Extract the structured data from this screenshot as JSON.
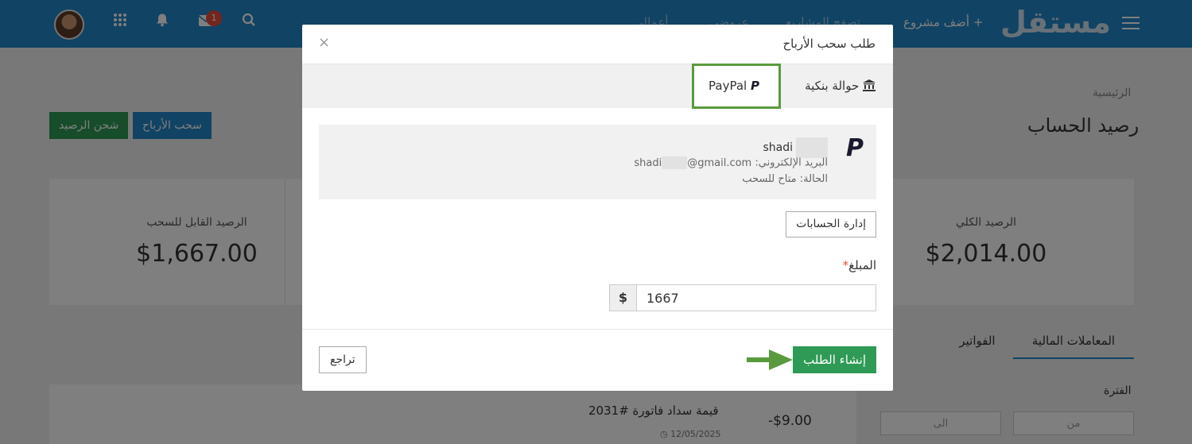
{
  "navbar": {
    "logo": "مستقل",
    "add_project": "+ أضف مشروع",
    "browse_projects": "تصفح المشاريع",
    "my_offers": "عروضي",
    "my_jobs": "أعمالي",
    "mail_badge": "1",
    "icons": [
      "hamburger-icon",
      "search-icon",
      "mail-icon",
      "bell-icon",
      "apps-grid-icon"
    ]
  },
  "page": {
    "breadcrumb": "الرئيسية",
    "title": "رصيد الحساب",
    "withdraw_button": "سحب الأرباح",
    "topup_button": "شحن الرصيد",
    "stats": {
      "available_label": "الرصيد القابل للسحب",
      "available_value": "$1,667.00",
      "total_label": "الرصيد الكلي",
      "total_value": "$2,014.00"
    },
    "tabs": {
      "transactions": "المعاملات المالية",
      "invoices": "الفواتير"
    },
    "period": {
      "label": "الفترة",
      "from_placeholder": "من",
      "to_placeholder": "الى"
    },
    "transaction": {
      "title": "قيمة سداد فاتورة #2031",
      "amount": "-$9.00",
      "date": "12/05/2025"
    }
  },
  "modal": {
    "title": "طلب سحب الأرباح",
    "close": "×",
    "methods": {
      "bank": "حوالة بنكية",
      "paypal": "PayPal"
    },
    "account": {
      "name": "shadi",
      "email_label": "البريد الإلكتروني:",
      "email_prefix": "shadi",
      "email_domain": "@gmail.com",
      "status": "الحالة: متاح للسحب"
    },
    "manage_accounts": "إدارة الحسابات",
    "amount_label": "المبلغ",
    "required_mark": "*",
    "currency": "$",
    "amount_value": "1667",
    "submit": "إنشاء الطلب",
    "back": "تراجع"
  },
  "colors": {
    "navbar": "#2386c8",
    "primary_green": "#2e9a55",
    "highlight_green": "#5a9a3e"
  }
}
